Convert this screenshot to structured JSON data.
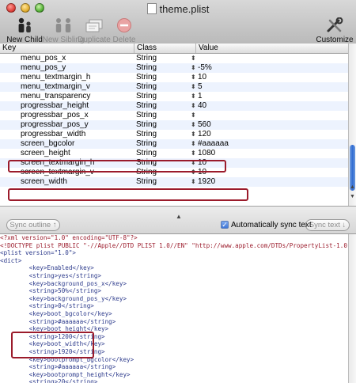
{
  "window": {
    "title": "theme.plist"
  },
  "toolbar": {
    "new_child": "New Child",
    "new_sibling": "New Sibling",
    "duplicate": "Duplicate",
    "delete": "Delete",
    "customize": "Customize"
  },
  "table": {
    "headers": {
      "key": "Key",
      "class": "Class",
      "value": "Value"
    },
    "rows": [
      {
        "key": "menu_pos_x",
        "class": "String",
        "value": ""
      },
      {
        "key": "menu_pos_y",
        "class": "String",
        "value": "-5%"
      },
      {
        "key": "menu_textmargin_h",
        "class": "String",
        "value": "10"
      },
      {
        "key": "menu_textmargin_v",
        "class": "String",
        "value": "5"
      },
      {
        "key": "menu_transparency",
        "class": "String",
        "value": "1"
      },
      {
        "key": "progressbar_height",
        "class": "String",
        "value": "40"
      },
      {
        "key": "progressbar_pos_x",
        "class": "String",
        "value": ""
      },
      {
        "key": "progressbar_pos_y",
        "class": "String",
        "value": "560"
      },
      {
        "key": "progressbar_width",
        "class": "String",
        "value": "120"
      },
      {
        "key": "screen_bgcolor",
        "class": "String",
        "value": "#aaaaaa"
      },
      {
        "key": "screen_height",
        "class": "String",
        "value": "1080"
      },
      {
        "key": "screen_textmargin_h",
        "class": "String",
        "value": "10"
      },
      {
        "key": "screen_textmargin_v",
        "class": "String",
        "value": "10"
      },
      {
        "key": "screen_width",
        "class": "String",
        "value": "1920"
      }
    ]
  },
  "controls": {
    "sync_outline": "Sync outline ↑",
    "auto_sync_label": "Automatically sync text",
    "auto_sync_checked": true,
    "sync_text": "Sync text ↓"
  },
  "xml_lines": [
    "<?xml version=\"1.0\" encoding=\"UTF-8\"?>",
    "<!DOCTYPE plist PUBLIC \"-//Apple//DTD PLIST 1.0//EN\" \"http://www.apple.com/DTDs/PropertyList-1.0.dtd\">",
    "<plist version=\"1.0\">",
    "<dict>",
    "        <key>Enabled</key>",
    "        <string>yes</string>",
    "        <key>background_pos_x</key>",
    "        <string>50%</string>",
    "        <key>background_pos_y</key>",
    "        <string>0</string>",
    "        <key>boot_bgcolor</key>",
    "        <string>#aaaaaa</string>",
    "        <key>boot_height</key>",
    "        <string>1200</string>",
    "        <key>boot_width</key>",
    "        <string>1920</string>",
    "        <key>bootprompt_bgcolor</key>",
    "        <string>#aaaaaa</string>",
    "        <key>bootprompt_height</key>",
    "        <string>20</string>"
  ],
  "colors": {
    "highlight": "#9b1b2b",
    "row_alt": "#edf3fe",
    "scroll_thumb": "#2f6bd2"
  }
}
